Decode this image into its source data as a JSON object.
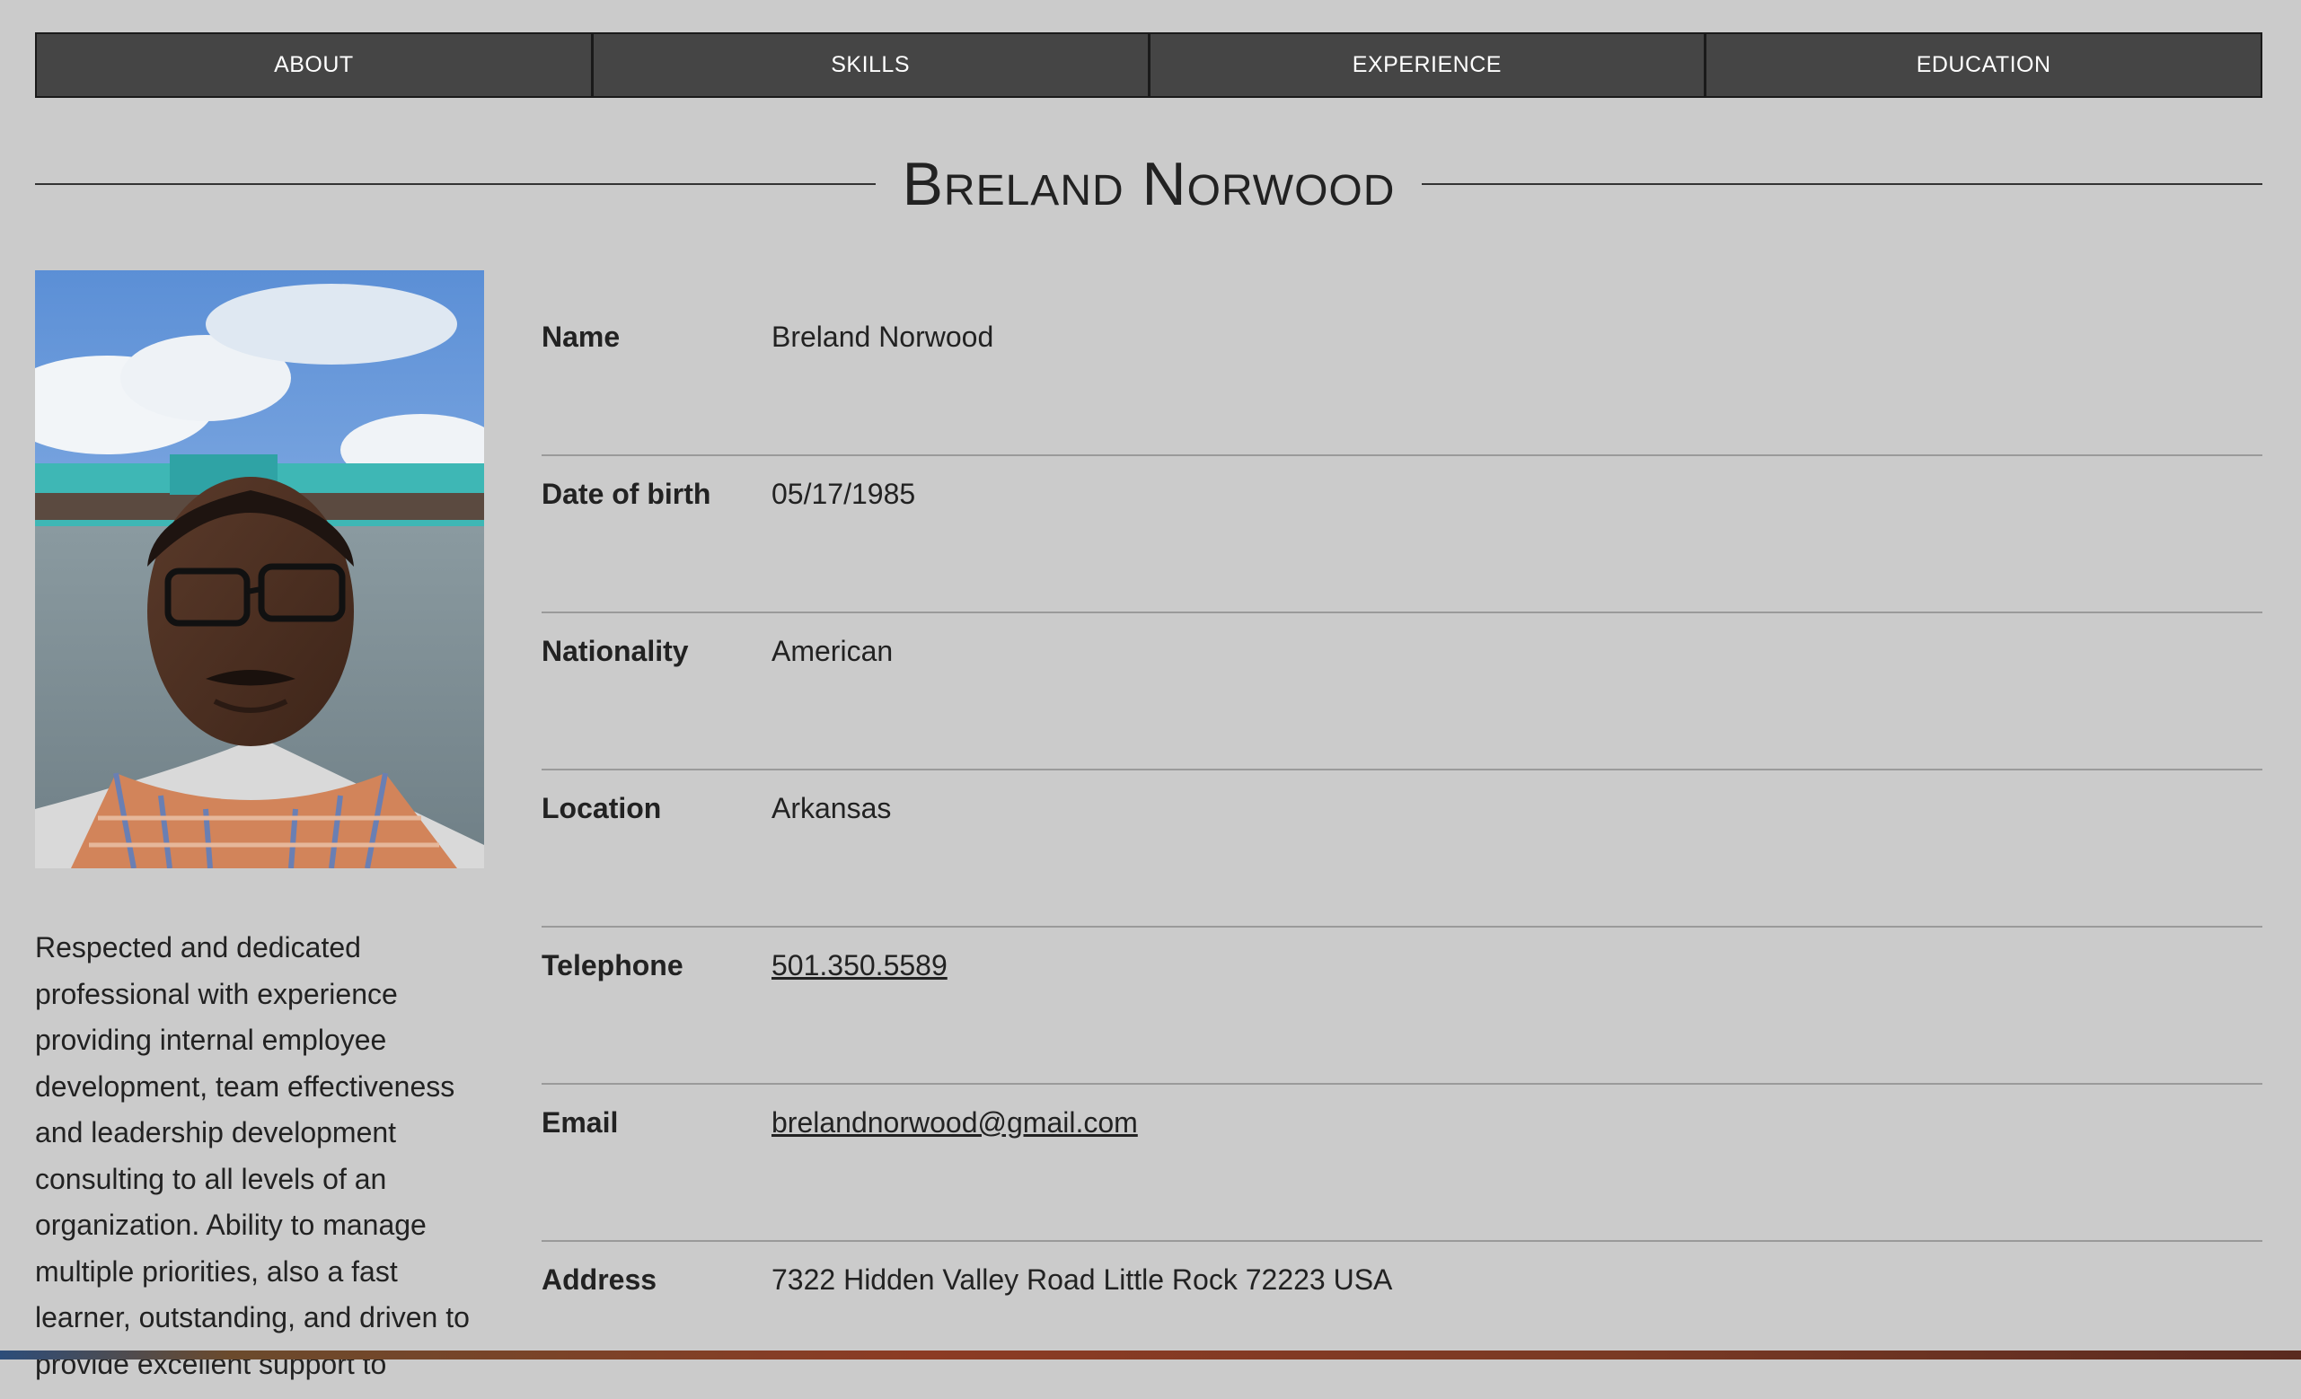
{
  "nav": {
    "items": [
      {
        "label": "ABOUT"
      },
      {
        "label": "SKILLS"
      },
      {
        "label": "EXPERIENCE"
      },
      {
        "label": "EDUCATION"
      }
    ]
  },
  "header": {
    "title": "Breland Norwood"
  },
  "profile": {
    "photo_alt": "profile photo",
    "bio": "Respected and dedicated professional with experience providing internal employee development, team effectiveness and leadership development consulting to all levels of an organization. Ability to manage multiple priorities, also a fast learner, outstanding, and driven to provide excellent support to"
  },
  "info": {
    "rows": [
      {
        "label": "Name",
        "value": "Breland Norwood"
      },
      {
        "label": "Date of birth",
        "value": "05/17/1985"
      },
      {
        "label": "Nationality",
        "value": "American"
      },
      {
        "label": "Location",
        "value": "Arkansas"
      },
      {
        "label": "Telephone",
        "value": "501.350.5589"
      },
      {
        "label": "Email",
        "value": "brelandnorwood@gmail.com"
      },
      {
        "label": "Address",
        "value": "7322 Hidden Valley Road Little Rock 72223 USA"
      }
    ]
  },
  "colors": {
    "background": "#cbcbcb",
    "nav_background": "#454545",
    "nav_text": "#ffffff",
    "text": "#222222",
    "divider": "#9a9a9a"
  }
}
